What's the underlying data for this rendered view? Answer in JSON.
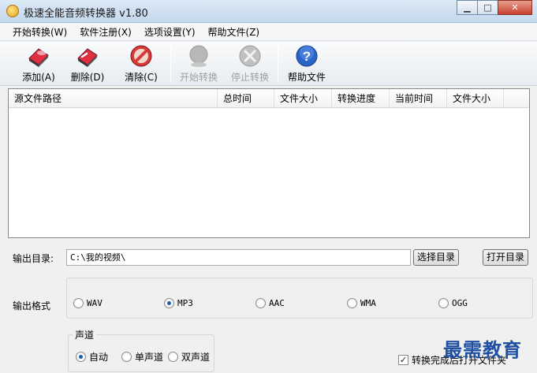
{
  "window": {
    "title": "极速全能音频转换器 v1.80",
    "minimize_glyph": "▁",
    "maximize_glyph": "□",
    "close_glyph": "✕"
  },
  "menu": [
    {
      "label": "开始转换(W)"
    },
    {
      "label": "软件注册(X)"
    },
    {
      "label": "选项设置(Y)"
    },
    {
      "label": "帮助文件(Z)"
    }
  ],
  "toolbar": {
    "add": {
      "label": "添加(A)",
      "icon": "add-eraser-icon"
    },
    "delete": {
      "label": "删除(D)",
      "icon": "delete-eraser-icon"
    },
    "clear": {
      "label": "清除(C)",
      "icon": "no-entry-icon"
    },
    "start": {
      "label": "开始转换",
      "icon": "start-convert-icon"
    },
    "stop": {
      "label": "停止转换",
      "icon": "stop-convert-icon"
    },
    "help": {
      "label": "帮助文件",
      "icon": "help-question-icon"
    }
  },
  "list": {
    "columns": [
      "源文件路径",
      "总时间",
      "文件大小",
      "转换进度",
      "当前时间",
      "文件大小"
    ]
  },
  "output": {
    "label": "输出目录:",
    "path": "C:\\我的视频\\",
    "choose_button": "选择目录",
    "open_button": "打开目录"
  },
  "format": {
    "label": "输出格式",
    "options": [
      "WAV",
      "MP3",
      "AAC",
      "WMA",
      "OGG"
    ],
    "selected": "MP3"
  },
  "channel": {
    "title": "声道",
    "options": [
      "自动",
      "单声道",
      "双声道"
    ],
    "selected": "自动"
  },
  "open_after": {
    "label": "转换完成后打开文件夹",
    "checked": true,
    "check_glyph": "✓"
  },
  "watermark": "最需教育",
  "colors": {
    "accent": "#1c5fa8",
    "watermark": "#1f4fa0"
  }
}
